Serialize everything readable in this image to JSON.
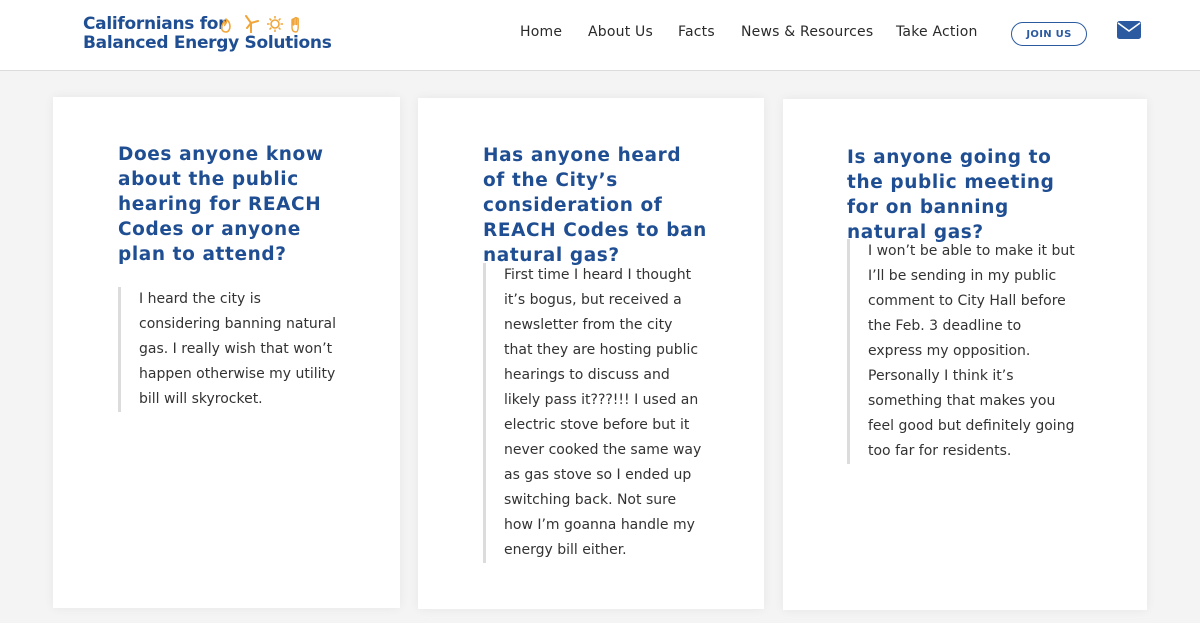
{
  "brand": {
    "line1": "Californians for",
    "line2": "Balanced Energy Solutions",
    "colors": {
      "primary": "#1f4e92",
      "accent": "#f0a53a"
    },
    "icons": [
      "flame-icon",
      "wind-turbine-icon",
      "sun-icon",
      "hand-icon"
    ]
  },
  "nav": {
    "items": [
      {
        "label": "Home"
      },
      {
        "label": "About Us"
      },
      {
        "label": "Facts"
      },
      {
        "label": "News & Resources"
      },
      {
        "label": "Take Action"
      }
    ],
    "join_label": "JOIN US",
    "mail_icon": "envelope-icon"
  },
  "cards": [
    {
      "title": "Does anyone know about the public hearing for REACH Codes or anyone plan to attend?",
      "quote": "I heard the city is considering banning natural gas. I really wish that won’t happen otherwise my utility bill will skyrocket."
    },
    {
      "title": "Has anyone heard of the City’s consideration of REACH Codes to ban natural gas?",
      "quote": "First time I heard I thought it’s bogus, but received a newsletter from the city that they are hosting public hearings to discuss and likely pass it???!!! I used an electric stove before but it never cooked the same way as gas stove so I ended up switching back. Not sure how I’m goanna handle my energy bill either."
    },
    {
      "title": "Is anyone going to the public meeting for on banning natural gas?",
      "quote": "I won’t be able to make it but I’ll be sending in my public comment to City Hall before the Feb. 3 deadline to express my opposition. Personally I think it’s something that makes you feel good but definitely going too far for residents."
    }
  ]
}
